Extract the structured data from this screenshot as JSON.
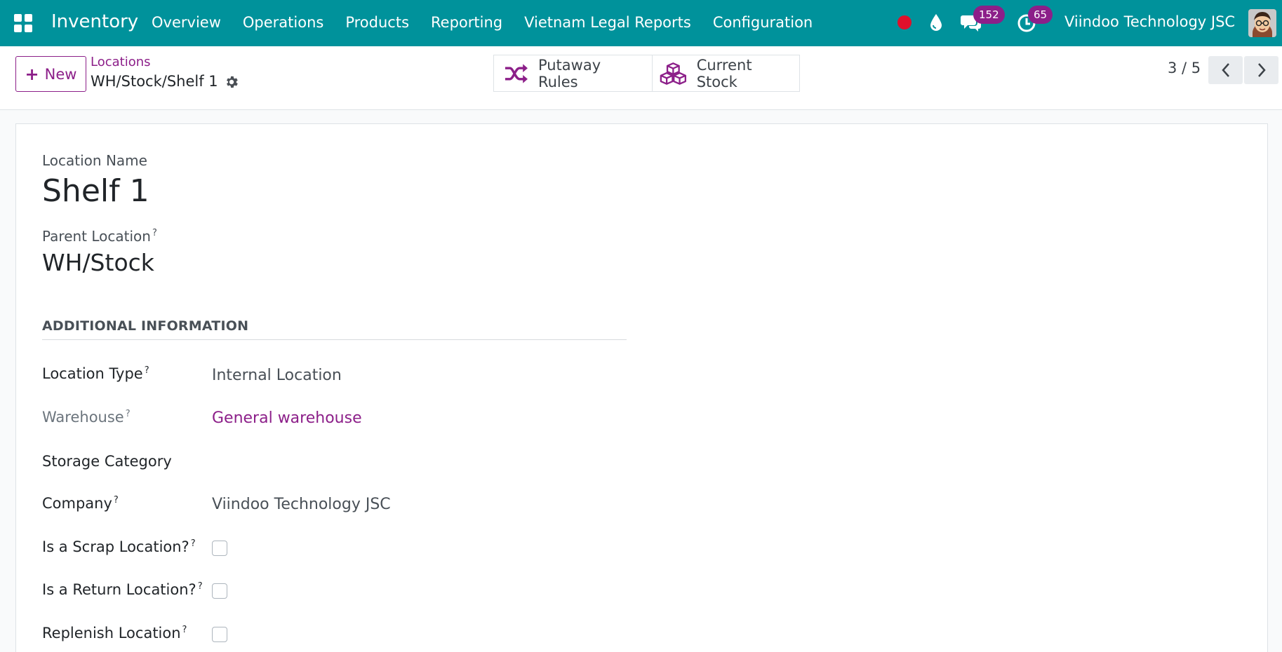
{
  "navbar": {
    "app_name": "Inventory",
    "menu": [
      "Overview",
      "Operations",
      "Products",
      "Reporting",
      "Vietnam Legal Reports",
      "Configuration"
    ],
    "messages_count": "152",
    "activities_count": "65",
    "company": "Viindoo Technology JSC",
    "color": "#00929b"
  },
  "control": {
    "new_label": "New",
    "breadcrumb_parent": "Locations",
    "breadcrumb_current": "WH/Stock/Shelf 1",
    "smart_buttons": {
      "putaway": "Putaway Rules",
      "stock": "Current Stock"
    },
    "pager": "3 / 5"
  },
  "form": {
    "name_label": "Location Name",
    "name_value": "Shelf 1",
    "parent_label": "Parent Location",
    "parent_value": "WH/Stock",
    "section_title": "ADDITIONAL INFORMATION",
    "fields": {
      "location_type": {
        "label": "Location Type",
        "value": "Internal Location"
      },
      "warehouse": {
        "label": "Warehouse",
        "value": "General warehouse"
      },
      "storage_category": {
        "label": "Storage Category",
        "value": ""
      },
      "company": {
        "label": "Company",
        "value": "Viindoo Technology JSC"
      },
      "scrap": {
        "label": "Is a Scrap Location?",
        "checked": false
      },
      "return": {
        "label": "Is a Return Location?",
        "checked": false
      },
      "replenish": {
        "label": "Replenish Location",
        "checked": false
      }
    },
    "help_marker": "?"
  },
  "colors": {
    "accent": "#8c1f89",
    "navbar": "#00929b",
    "record_dot": "#e0102b"
  }
}
